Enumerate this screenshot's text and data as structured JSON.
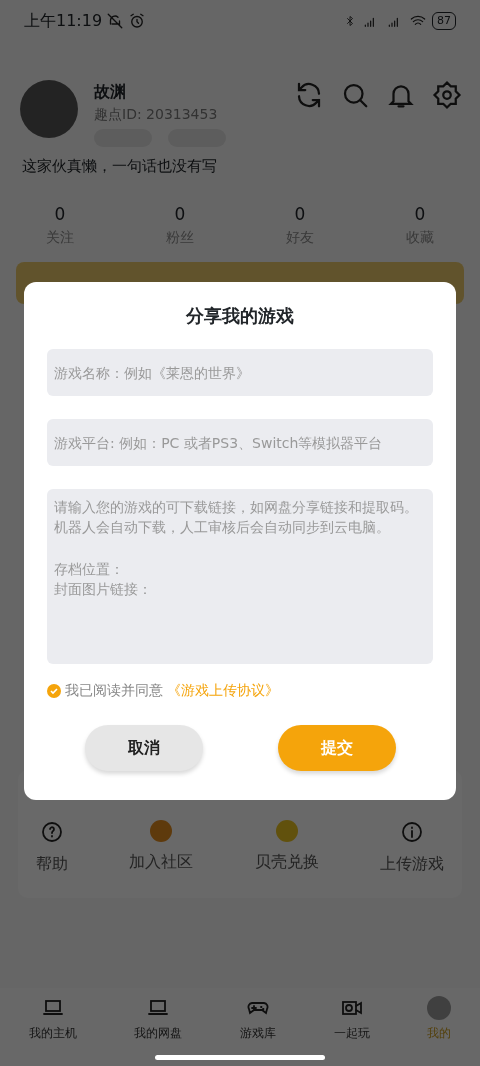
{
  "status_bar": {
    "time": "上午11:19",
    "battery": "87"
  },
  "profile": {
    "name": "故渊",
    "user_id": "趣点ID: 20313453",
    "bio": "这家伙真懒，一句话也没有写"
  },
  "stats": [
    {
      "value": "0",
      "label": "关注"
    },
    {
      "value": "0",
      "label": "粉丝"
    },
    {
      "value": "0",
      "label": "好友"
    },
    {
      "value": "0",
      "label": "收藏"
    }
  ],
  "more": {
    "items": [
      {
        "kind": "help",
        "label": "帮助"
      },
      {
        "kind": "community",
        "label": "加入社区"
      },
      {
        "kind": "shell",
        "label": "贝壳兑换"
      },
      {
        "kind": "info",
        "label": "上传游戏"
      }
    ]
  },
  "bottom_nav": [
    {
      "kind": "laptop",
      "label": "我的主机",
      "selected": false
    },
    {
      "kind": "laptop",
      "label": "我的网盘",
      "selected": false
    },
    {
      "kind": "gamepad",
      "label": "游戏库",
      "selected": false
    },
    {
      "kind": "camera",
      "label": "一起玩",
      "selected": false
    },
    {
      "kind": "avatar",
      "label": "我的",
      "selected": true
    }
  ],
  "dialog": {
    "title": "分享我的游戏",
    "fields": [
      {
        "kind": "input",
        "placeholder": "游戏名称：例如《莱恩的世界》"
      },
      {
        "kind": "input",
        "placeholder": "游戏平台: 例如：PC 或者PS3、Switch等模拟器平台"
      },
      {
        "kind": "textarea",
        "placeholder": "请输入您的游戏的可下载链接，如网盘分享链接和提取码。机器人会自动下载，人工审核后会自动同步到云电脑。",
        "more_lines": [
          "存档位置：",
          "封面图片链接："
        ]
      }
    ],
    "agreement": {
      "checked": true,
      "text": "我已阅读并同意",
      "link": "《游戏上传协议》"
    },
    "buttons": [
      {
        "kind": "cancel",
        "label": "取消"
      },
      {
        "kind": "submit",
        "label": "提交"
      }
    ]
  }
}
